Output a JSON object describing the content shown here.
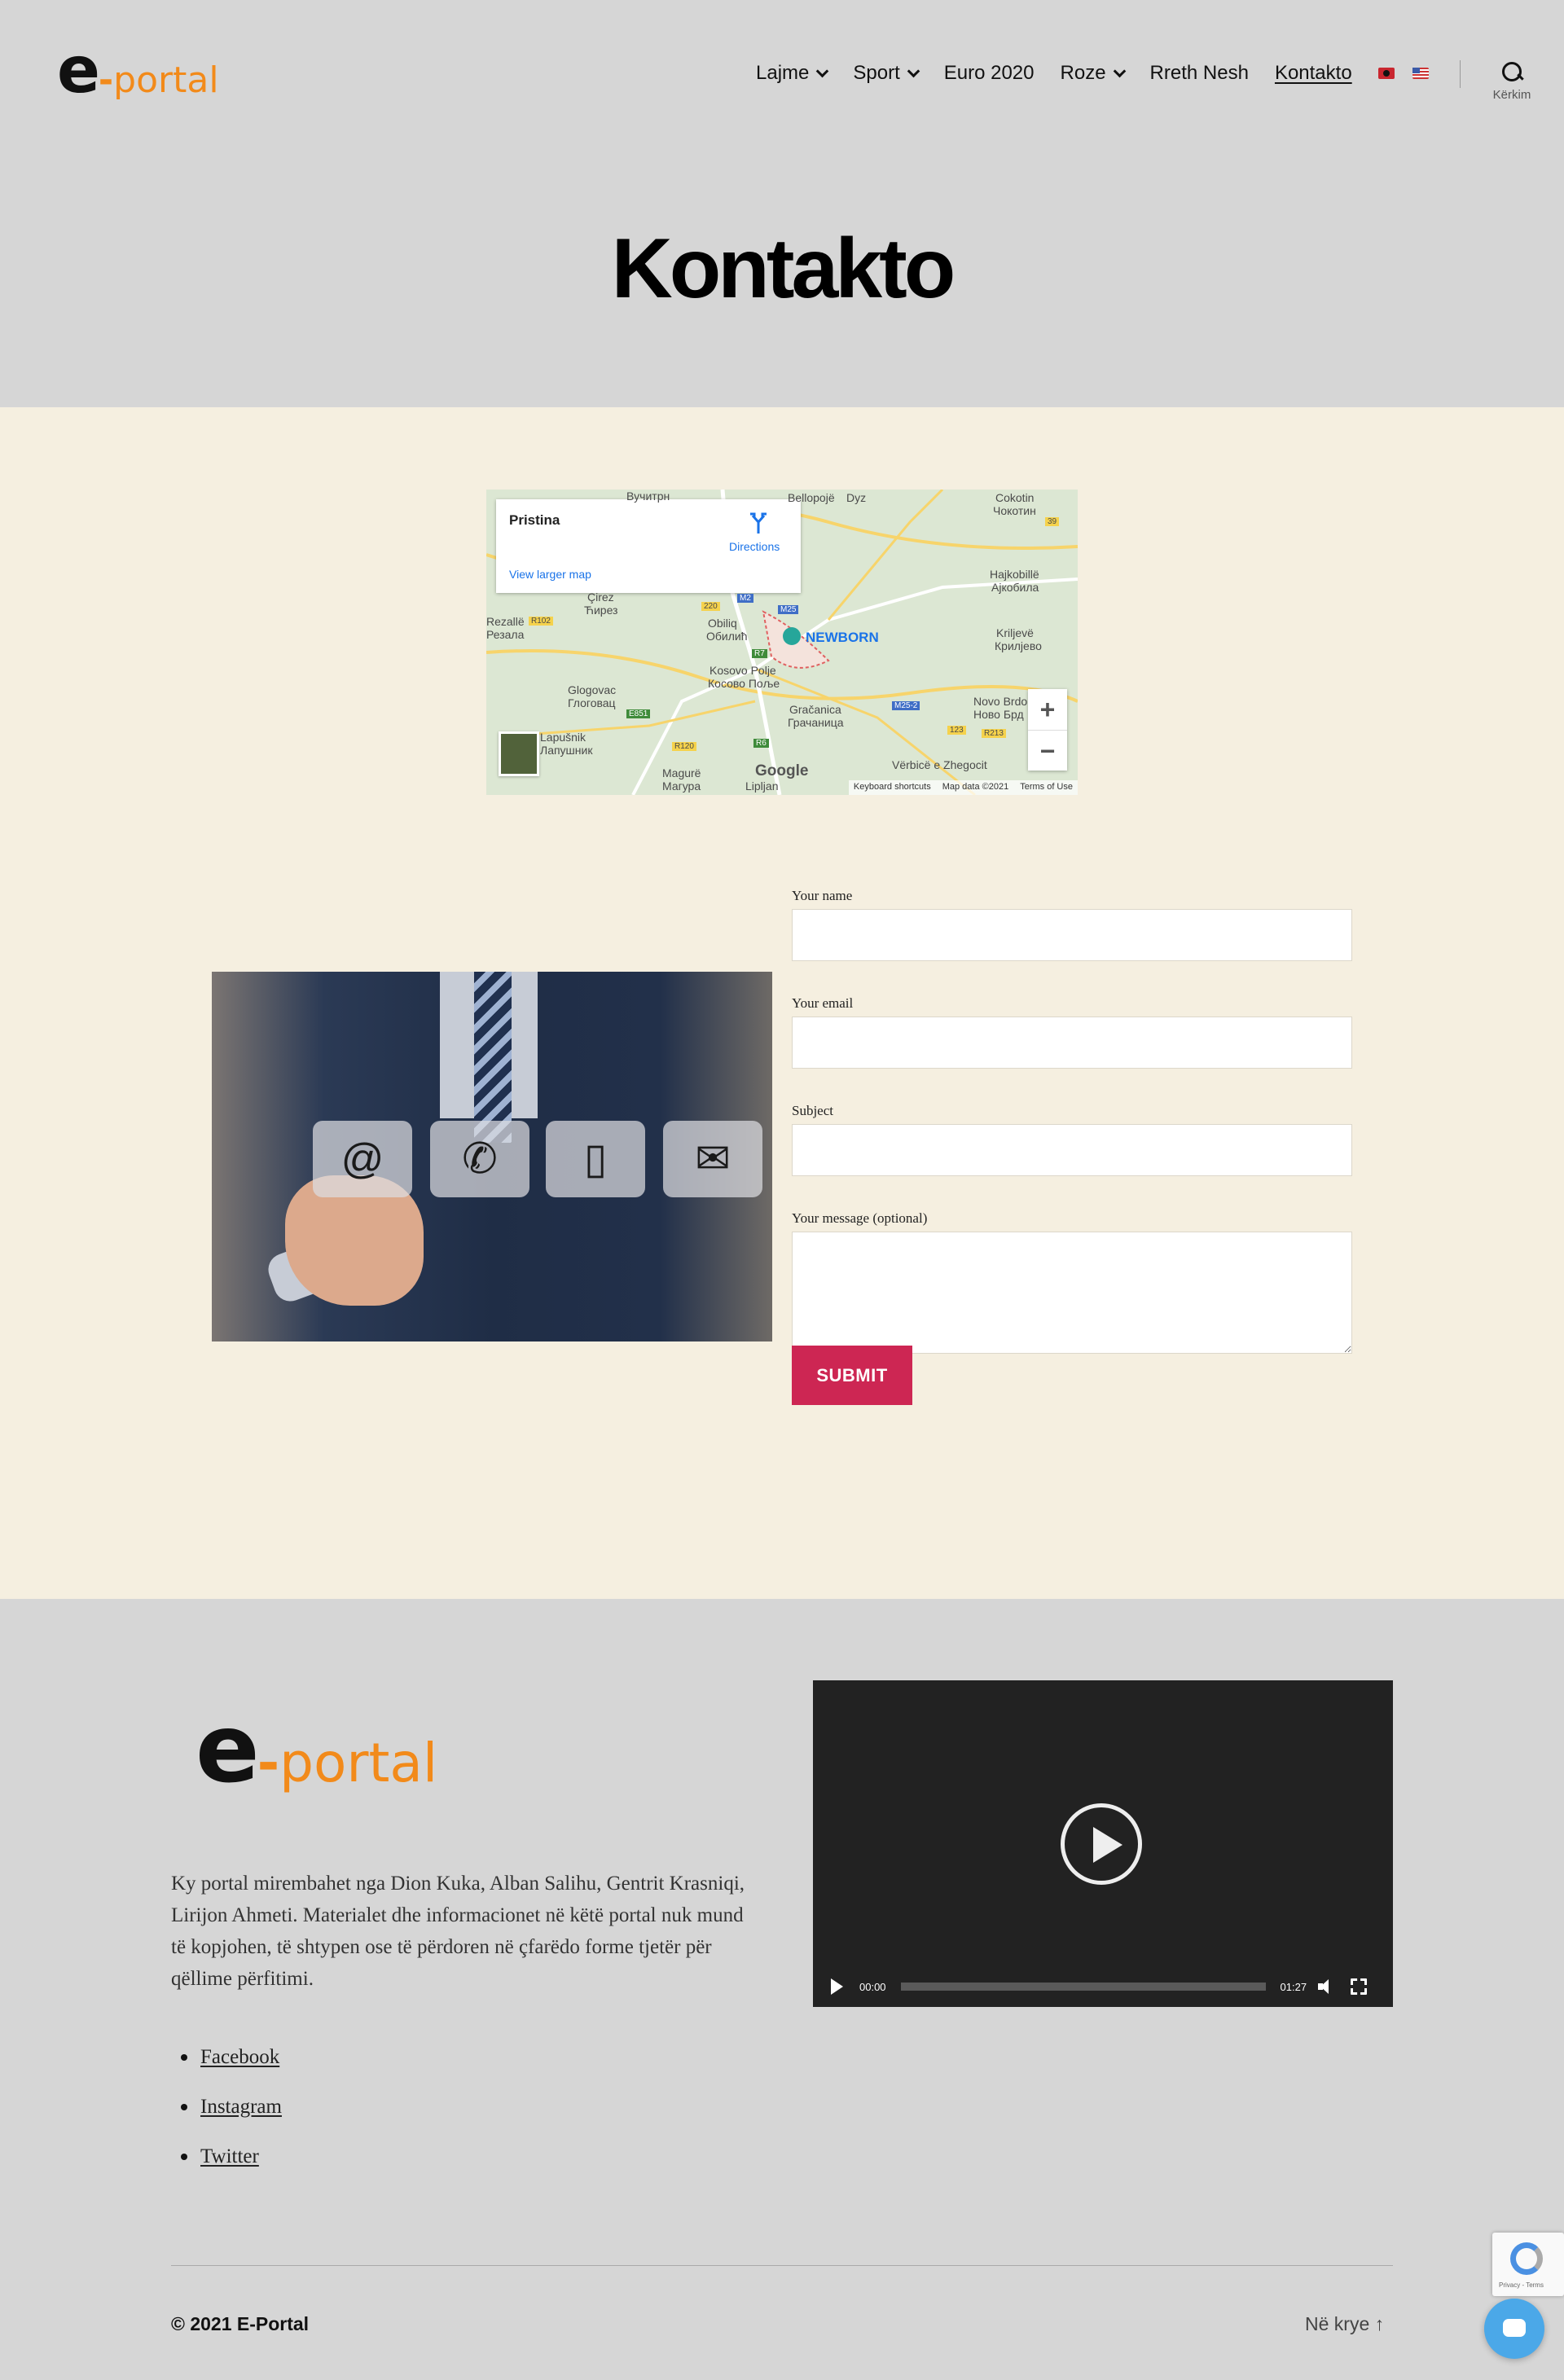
{
  "header": {
    "logo": {
      "e": "e",
      "dash": "-",
      "rest": "portal"
    },
    "nav": [
      {
        "label": "Lajme",
        "has_dropdown": true
      },
      {
        "label": "Sport",
        "has_dropdown": true
      },
      {
        "label": "Euro 2020",
        "has_dropdown": false
      },
      {
        "label": "Roze",
        "has_dropdown": true
      },
      {
        "label": "Rreth Nesh",
        "has_dropdown": false
      },
      {
        "label": "Kontakto",
        "has_dropdown": false,
        "active": true
      }
    ],
    "languages": [
      "albanian-flag-icon",
      "us-flag-icon"
    ],
    "search_label": "Kërkim",
    "search_icon": "search-icon"
  },
  "page_title": "Kontakto",
  "map": {
    "place": "Pristina",
    "directions": "Directions",
    "larger": "View larger map",
    "labels": [
      "Вучитрн",
      "Bellopojë",
      "Dyz",
      "Cokotin",
      "Чокотин",
      "Hajkobillë",
      "Ајкобила",
      "Çirez",
      "Ћирез",
      "Rezallë",
      "Резала",
      "Obiliq",
      "Обилић",
      "NEWBORN",
      "Kosovo Polje",
      "Косово Поље",
      "Kriljevë",
      "Крилјево",
      "Glogovac",
      "Глоговац",
      "Gračanica",
      "Грачаница",
      "Novo Brdo",
      "Ново Брд",
      "Lapušnik",
      "Лапушник",
      "Magurë",
      "Магура",
      "Lipljan",
      "Vërbicë e Zhegocit"
    ],
    "roads": [
      "R102",
      "220",
      "M2",
      "M25",
      "R7",
      "E851",
      "R120",
      "R6",
      "M25-2",
      "123",
      "R213",
      "39"
    ],
    "zoom_in": "+",
    "zoom_out": "−",
    "google": "Google",
    "attribution": [
      "Keyboard shortcuts",
      "Map data ©2021",
      "Terms of Use"
    ]
  },
  "contact_image": {
    "tiles": [
      "@",
      "✆",
      "▯",
      "✉"
    ]
  },
  "form": {
    "name_label": "Your name",
    "email_label": "Your email",
    "subject_label": "Subject",
    "message_label": "Your message (optional)",
    "name_value": "",
    "email_value": "",
    "subject_value": "",
    "message_value": "",
    "submit": "SUBMIT"
  },
  "footer": {
    "logo": {
      "e": "e",
      "dash": "-",
      "rest": "portal"
    },
    "about": "Ky portal mirembahet nga Dion Kuka, Alban Salihu, Gentrit Krasniqi, Lirijon Ahmeti. Materialet dhe informacionet në këtë portal nuk mund të kopjohen, të shtypen ose të përdoren në çfarëdo forme tjetër për qëllime përfitimi.",
    "social": [
      "Facebook",
      "Instagram",
      "Twitter"
    ],
    "video": {
      "current": "00:00",
      "duration": "01:27"
    },
    "copyright": "© 2021 E-Portal",
    "to_top": "Në krye ↑",
    "recaptcha": "Privacy - Terms"
  },
  "colors": {
    "accent": "#cd2653",
    "brand_orange": "#f28a1a",
    "header_bg": "#d6d6d6",
    "main_bg": "#f5efe0"
  }
}
